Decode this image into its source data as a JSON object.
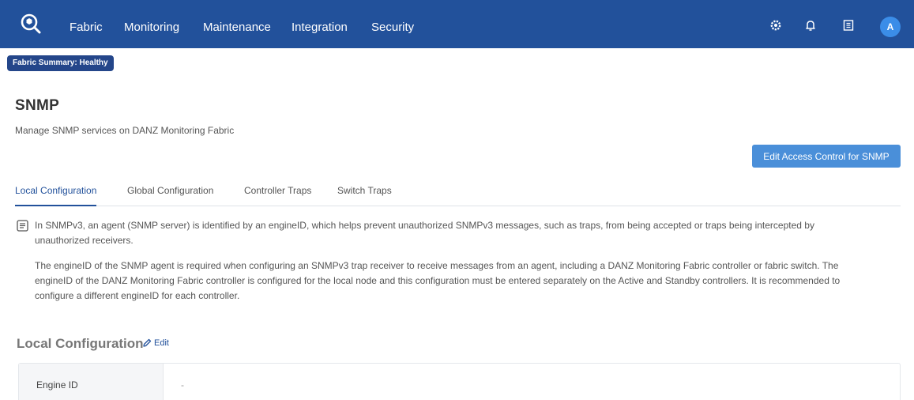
{
  "nav": {
    "items": [
      {
        "label": "Fabric"
      },
      {
        "label": "Monitoring"
      },
      {
        "label": "Maintenance"
      },
      {
        "label": "Integration"
      },
      {
        "label": "Security"
      }
    ],
    "avatar_initial": "A",
    "icons": [
      "gear-icon",
      "bell-icon",
      "document-icon"
    ]
  },
  "summary_badge": "Fabric Summary: Healthy",
  "page": {
    "title": "SNMP",
    "subtitle": "Manage SNMP services on DANZ Monitoring Fabric"
  },
  "edit_access_button": "Edit Access Control for SNMP",
  "tabs": [
    {
      "label": "Local Configuration",
      "active": true
    },
    {
      "label": "Global Configuration",
      "active": false
    },
    {
      "label": "Controller Traps",
      "active": false
    },
    {
      "label": "Switch Traps",
      "active": false
    }
  ],
  "info": {
    "p1_line1": "In SNMPv3, an agent (SNMP server) is identified by an engineID, which helps prevent unauthorized SNMPv3 messages, such as traps, from being accepted or traps being intercepted by",
    "p1_line2": "unauthorized receivers.",
    "p2_line1": "The engineID of the SNMP agent is required when configuring an SNMPv3 trap receiver to receive messages from an agent, including a DANZ Monitoring Fabric controller or fabric switch. The",
    "p2_line2": "engineID of the DANZ Monitoring Fabric controller is configured for the local node and this configuration must be entered separately on the Active and Standby controllers. It is recommended to",
    "p2_line3": "configure a different engineID for each controller."
  },
  "local_config": {
    "title": "Local Configuration",
    "edit_label": "Edit",
    "rows": [
      {
        "label": "Engine ID",
        "value": "-"
      }
    ]
  },
  "colors": {
    "topbar": "#22519b",
    "primary_button": "#4a8fd9",
    "badge": "#24468a",
    "link": "#22519b"
  }
}
